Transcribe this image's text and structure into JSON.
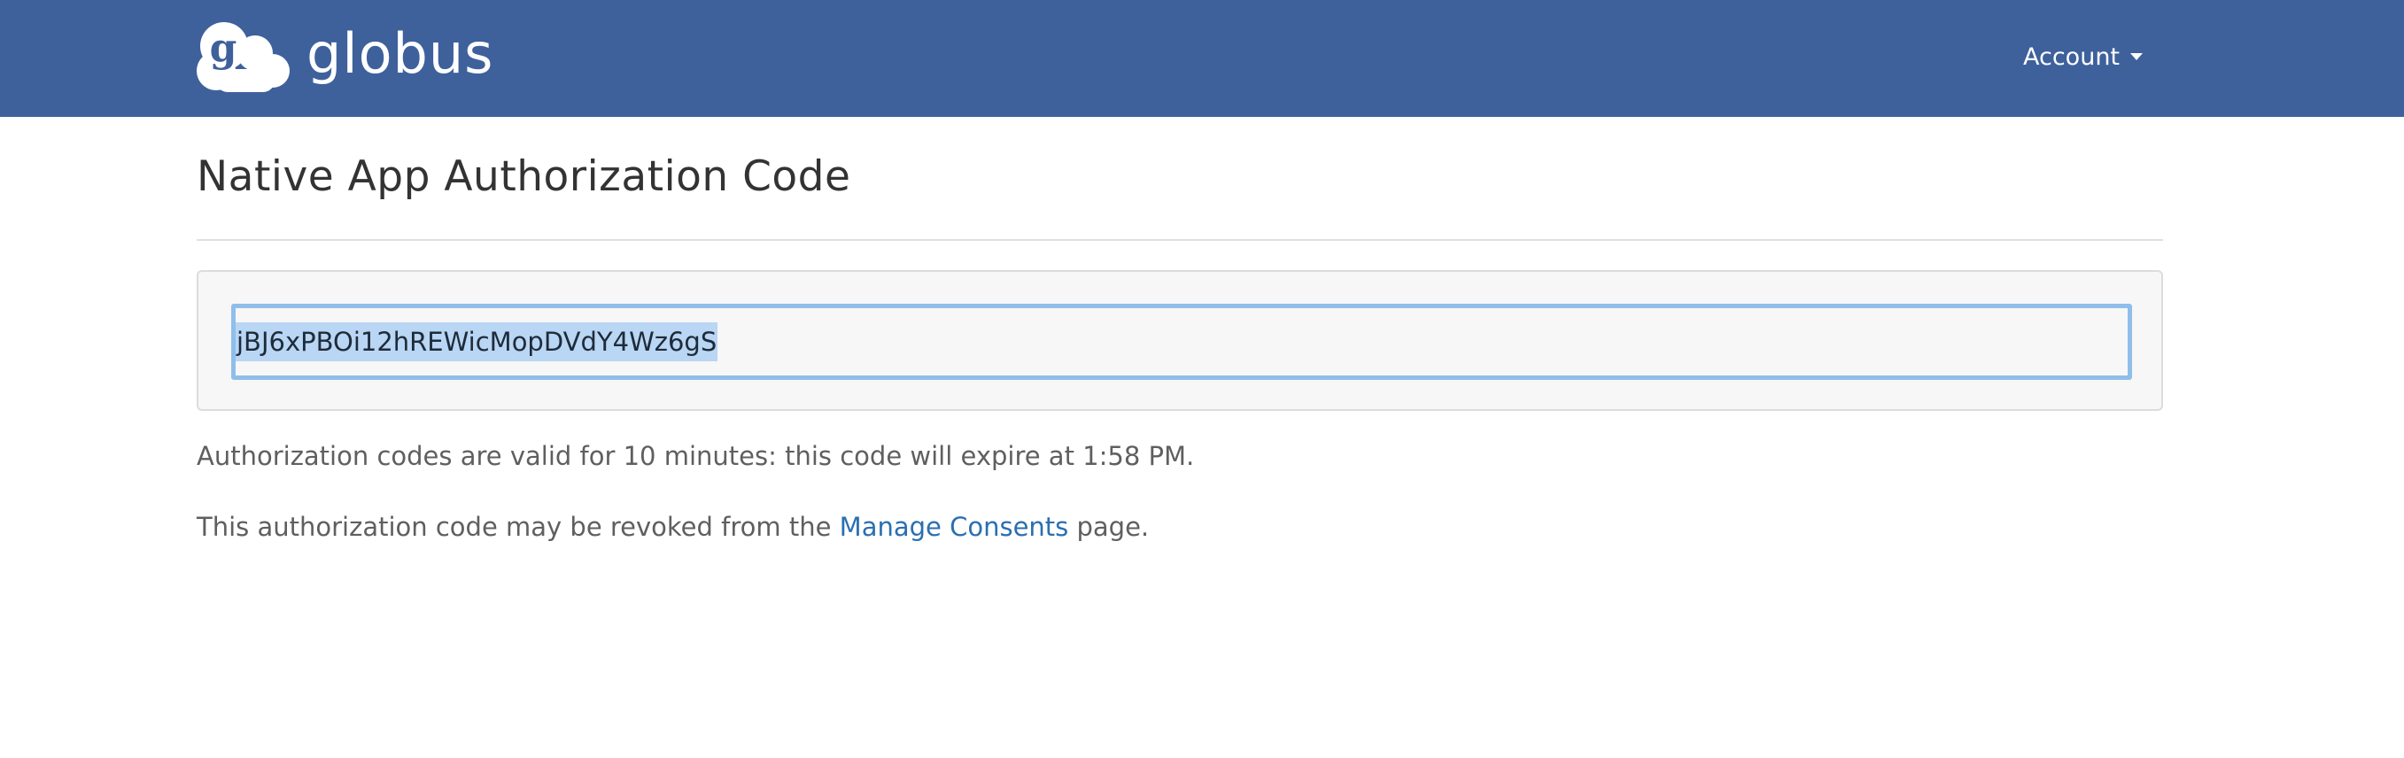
{
  "header": {
    "brand_name": "globus",
    "logo_letter": "g",
    "account_label": "Account",
    "background_color": "#3e619c"
  },
  "main": {
    "title": "Native App Authorization Code",
    "auth_code": "jBJ6xPBOi12hREWicMopDVdY4Wz6gS",
    "validity_text": "Authorization codes are valid for 10 minutes: this code will expire at 1:58 PM.",
    "revoke_prefix": "This authorization code may be revoked from the ",
    "revoke_link": "Manage Consents",
    "revoke_suffix": " page."
  },
  "colors": {
    "link": "#2a6fb1",
    "selection_highlight": "#b9d6f4",
    "focus_border": "#8fbeea"
  },
  "icons": {
    "logo": "globus-cloud-logo-icon",
    "dropdown": "caret-down-icon"
  }
}
